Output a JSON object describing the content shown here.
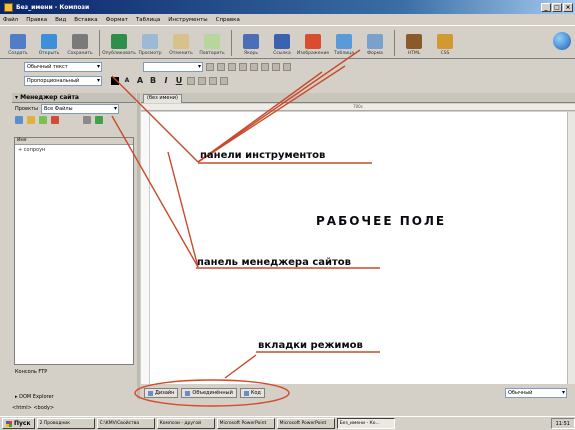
{
  "window": {
    "title": "Без_имени - Компози"
  },
  "menu": [
    "Файл",
    "Правка",
    "Вид",
    "Вставка",
    "Формат",
    "Таблица",
    "Инструменты",
    "Справка"
  ],
  "toolbar": {
    "buttons": [
      {
        "label": "Создать",
        "color": "#4f7dc7"
      },
      {
        "label": "Открыть",
        "color": "#3c8fd9"
      },
      {
        "label": "Сохранить",
        "color": "#7a7a7a"
      },
      {
        "label": "Опубликовать",
        "color": "#2f8f4a"
      },
      {
        "label": "Просмотр",
        "color": "#9bbad6"
      },
      {
        "label": "Отменить",
        "color": "#d8c18a"
      },
      {
        "label": "Повторить",
        "color": "#b6d69b"
      },
      {
        "label": "Якорь",
        "color": "#4a6fb8"
      },
      {
        "label": "Ссылка",
        "color": "#3a62b0"
      },
      {
        "label": "Изображение",
        "color": "#d94c2f"
      },
      {
        "label": "Таблица",
        "color": "#5a9ad8"
      },
      {
        "label": "Форма",
        "color": "#7aa0cc"
      },
      {
        "label": "HTML",
        "color": "#8a5a2a"
      },
      {
        "label": "CSS",
        "color": "#d09a30"
      }
    ]
  },
  "format": {
    "style_combo": "Обычный текст",
    "font_combo": "Пропорциональный",
    "bold": "B",
    "italic": "I",
    "underline": "U"
  },
  "sidebar": {
    "title": "Менеджер сайта",
    "project_label": "Проекты",
    "project_value": "Все Файлы",
    "list_header": "Имя",
    "list_item": "+ сопроун",
    "ftp_label": "Консоль FTP",
    "dom_explorer": "DOM Explorer"
  },
  "status": {
    "path": "<html> <body>"
  },
  "editor": {
    "tab_label": "(без имени)",
    "ruler_text": "700с"
  },
  "mode_tabs": [
    "Дизайн",
    "Объединённый",
    "Код"
  ],
  "zoom": {
    "value": "Обычный"
  },
  "annotations": {
    "toolbars": "панели инструментов",
    "workarea": "РАБОЧЕЕ ПОЛЕ",
    "site_manager": "панель менеджера сайтов",
    "mode_tabs": "вкладки режимов"
  },
  "taskbar": {
    "start": "Пуск",
    "tasks": [
      "2 Проводник",
      "C:\\KMV\\Свойства",
      "Компози - другой",
      "Microsoft PowerPoint",
      "Microsoft PowerPoint",
      "Без_имени - Ко..."
    ],
    "tray": "11:51"
  },
  "colors": {
    "accent_line": "#c84a2a",
    "ellipse": "#d84a2a"
  }
}
